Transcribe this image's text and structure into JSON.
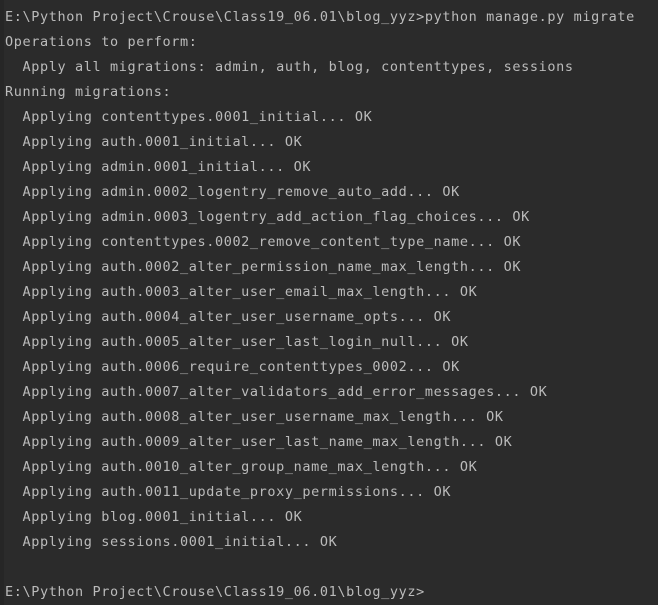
{
  "terminal": {
    "name": "pycharm-terminal",
    "background_color": "#2b2b2b",
    "gutter_color": "#262626",
    "text_color": "#bbbbbb",
    "prompt_path": "E:\\Python Project\\Crouse\\Class19_06.01\\blog_yyz>",
    "command": "python manage.py migrate",
    "lines": [
      "E:\\Python Project\\Crouse\\Class19_06.01\\blog_yyz>python manage.py migrate",
      "Operations to perform:",
      "  Apply all migrations: admin, auth, blog, contenttypes, sessions",
      "Running migrations:",
      "  Applying contenttypes.0001_initial... OK",
      "  Applying auth.0001_initial... OK",
      "  Applying admin.0001_initial... OK",
      "  Applying admin.0002_logentry_remove_auto_add... OK",
      "  Applying admin.0003_logentry_add_action_flag_choices... OK",
      "  Applying contenttypes.0002_remove_content_type_name... OK",
      "  Applying auth.0002_alter_permission_name_max_length... OK",
      "  Applying auth.0003_alter_user_email_max_length... OK",
      "  Applying auth.0004_alter_user_username_opts... OK",
      "  Applying auth.0005_alter_user_last_login_null... OK",
      "  Applying auth.0006_require_contenttypes_0002... OK",
      "  Applying auth.0007_alter_validators_add_error_messages... OK",
      "  Applying auth.0008_alter_user_username_max_length... OK",
      "  Applying auth.0009_alter_user_last_name_max_length... OK",
      "  Applying auth.0010_alter_group_name_max_length... OK",
      "  Applying auth.0011_update_proxy_permissions... OK",
      "  Applying blog.0001_initial... OK",
      "  Applying sessions.0001_initial... OK",
      "",
      "E:\\Python Project\\Crouse\\Class19_06.01\\blog_yyz>"
    ]
  }
}
